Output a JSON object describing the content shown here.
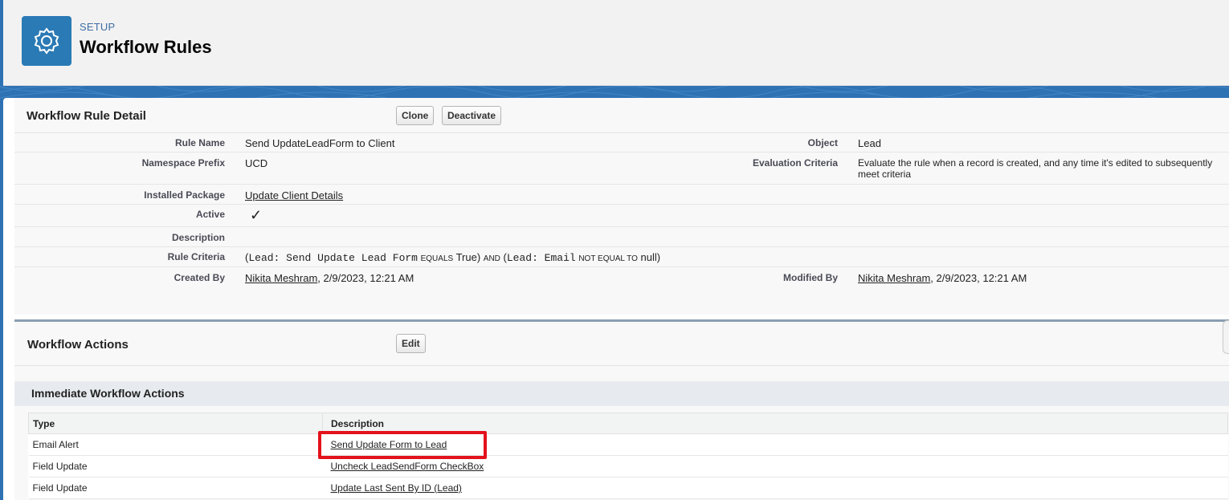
{
  "header": {
    "eyebrow": "SETUP",
    "title": "Workflow Rules",
    "icon": "gear-icon"
  },
  "detail": {
    "title": "Workflow Rule Detail",
    "buttons": {
      "clone": "Clone",
      "deactivate": "Deactivate"
    },
    "fields": {
      "rule_name_label": "Rule Name",
      "rule_name": "Send UpdateLeadForm to Client",
      "object_label": "Object",
      "object": "Lead",
      "namespace_label": "Namespace Prefix",
      "namespace": "UCD",
      "evaluation_label": "Evaluation Criteria",
      "evaluation": "Evaluate the rule when a record is created, and any time it's edited to subsequently meet criteria",
      "package_label": "Installed Package",
      "package": "Update Client Details",
      "active_label": "Active",
      "active_mark": "✓",
      "description_label": "Description",
      "criteria_label": "Rule Criteria",
      "criteria": {
        "open1": "(",
        "field1": "Lead: Send Update Lead Form",
        "op1": "EQUALS",
        "value1": "True)",
        "join": "AND",
        "open2": "(",
        "field2": "Lead: Email",
        "op2": "NOT EQUAL TO",
        "value2": "null)"
      },
      "created_label": "Created By",
      "created_user": "Nikita Meshram",
      "created_date": ", 2/9/2023, 12:21 AM",
      "modified_label": "Modified By",
      "modified_user": "Nikita Meshram",
      "modified_date": ", 2/9/2023, 12:21 AM"
    }
  },
  "actions": {
    "title": "Workflow Actions",
    "edit_label": "Edit",
    "immediate_title": "Immediate Workflow Actions",
    "columns": {
      "type": "Type",
      "description": "Description"
    },
    "rows": [
      {
        "type": "Email Alert",
        "description": "Send Update Form to Lead"
      },
      {
        "type": "Field Update",
        "description": "Uncheck LeadSendForm CheckBox"
      },
      {
        "type": "Field Update",
        "description": "Update Last Sent By ID (Lead)"
      }
    ]
  },
  "colors": {
    "brand_blue": "#2a7ab5",
    "highlight": "#e3121b"
  }
}
